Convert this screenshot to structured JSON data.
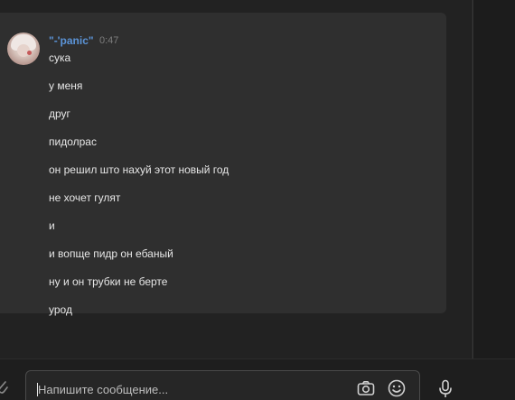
{
  "message": {
    "author": "\"-'panic\"",
    "time": "0:47",
    "lines": [
      "сука",
      "у меня",
      "друг",
      "пидолрас",
      "он решил што нахуй этот новый год",
      "не хочет гулят",
      "и",
      "и вопще пидр он ебаный",
      "ну и он трубки не берте",
      "урод"
    ]
  },
  "composer": {
    "placeholder": "Напишите сообщение..."
  },
  "icons": {
    "attach": "paperclip-icon",
    "camera": "camera-icon",
    "emoji": "smiley-icon",
    "voice": "microphone-icon"
  },
  "colors": {
    "background": "#222222",
    "message_bubble": "#2f2f2f",
    "author": "#5b93d6",
    "text": "#e6e6e6",
    "timestamp": "#7d7d7d"
  }
}
